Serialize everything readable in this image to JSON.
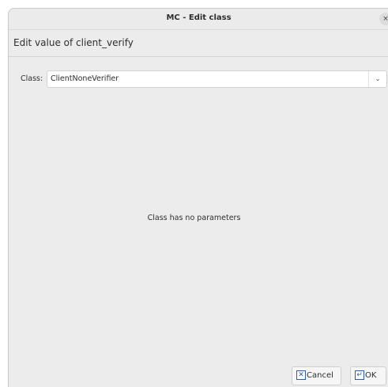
{
  "window": {
    "title": "MC - Edit class",
    "close_glyph": "×"
  },
  "header": {
    "heading": "Edit value of client_verify"
  },
  "form": {
    "class_label": "Class:",
    "class_value": "ClientNoneVerifier",
    "dropdown_glyph": "⌄"
  },
  "body": {
    "message": "Class has no parameters"
  },
  "buttons": {
    "cancel_label": "Cancel",
    "cancel_icon": "✕",
    "ok_label": "OK",
    "ok_icon": "↵"
  }
}
